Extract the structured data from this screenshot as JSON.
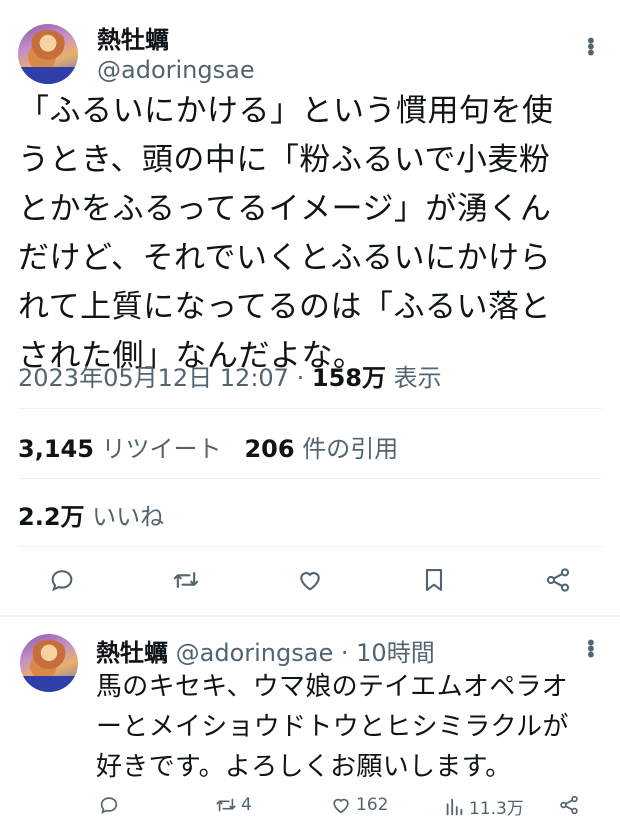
{
  "main_tweet": {
    "display_name": "熱牡蠣",
    "handle": "@adoringsae",
    "text": "「ふるいにかける」という慣用句を使\nうとき、頭の中に「粉ふるいで小麦粉\nとかをふるってるイメージ」が湧くん\nだけど、それでいくとふるいにかけら\nれて上質になってるのは「ふるい落と\nされた側」なんだよな。",
    "timestamp": "2023年05月12日 12:07",
    "separator": "·",
    "views_count": "158万",
    "views_label": "表示",
    "retweets_count": "3,145",
    "retweets_label": "リツイート",
    "quotes_count": "206",
    "quotes_label": "件の引用",
    "likes_count": "2.2万",
    "likes_label": "いいね"
  },
  "action_icons": [
    "reply-icon",
    "retweet-icon",
    "like-icon",
    "bookmark-icon",
    "share-icon"
  ],
  "reply_tweet": {
    "display_name": "熱牡蠣",
    "handle": "@adoringsae",
    "separator": "·",
    "time_ago": "10時間",
    "text": "馬のキセキ、ウマ娘のテイエムオペラオ\nーとメイショウドトウとヒシミラクルが\n好きです。よろしくお願いします。",
    "retweets": "4",
    "likes": "162",
    "views": "11.3万"
  },
  "colors": {
    "text": "#0f1419",
    "secondary": "#536471",
    "divider": "#eff3f4"
  }
}
